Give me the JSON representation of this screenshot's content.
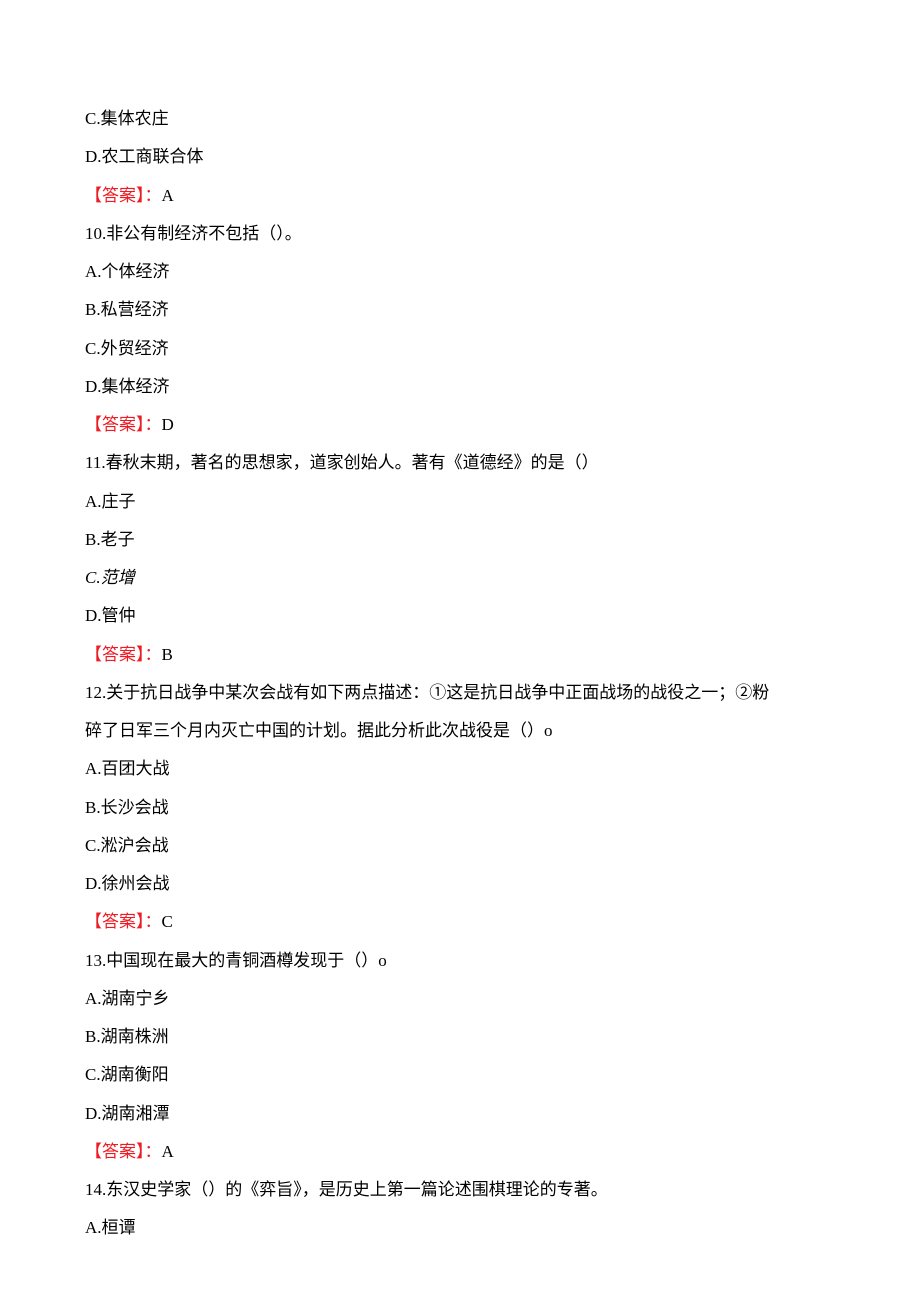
{
  "q9": {
    "optC": "C.集体农庄",
    "optD": "D.农工商联合体",
    "answerLabel": "【答案】：",
    "answerValue": "A"
  },
  "q10": {
    "stem": "10.非公有制经济不包括（）。",
    "optA": "A.个体经济",
    "optB": "B.私营经济",
    "optC": "C.外贸经济",
    "optD": "D.集体经济",
    "answerLabel": "【答案】：",
    "answerValue": "D"
  },
  "q11": {
    "stem": "11.春秋末期，著名的思想家，道家创始人。著有《道德经》的是（）",
    "optA": "A.庄子",
    "optB": "B.老子",
    "optC": "C.范增",
    "optD": "D.管仲",
    "answerLabel": "【答案】：",
    "answerValue": "B"
  },
  "q12": {
    "stemLine1": "12.关于抗日战争中某次会战有如下两点描述：①这是抗日战争中正面战场的战役之一；②粉",
    "stemLine2": "碎了日军三个月内灭亡中国的计划。据此分析此次战役是（）o",
    "optA": "A.百团大战",
    "optB": "B.长沙会战",
    "optC": "C.淞沪会战",
    "optD": "D.徐州会战",
    "answerLabel": "【答案】：",
    "answerValue": "C"
  },
  "q13": {
    "stem": "13.中国现在最大的青铜酒樽发现于（）o",
    "optA": "A.湖南宁乡",
    "optB": "B.湖南株洲",
    "optC": "C.湖南衡阳",
    "optD": "D.湖南湘潭",
    "answerLabel": "【答案】：",
    "answerValue": "A"
  },
  "q14": {
    "stem": "14.东汉史学家（）的《弈旨》，是历史上第一篇论述围棋理论的专著。",
    "optA": "A.桓谭"
  }
}
